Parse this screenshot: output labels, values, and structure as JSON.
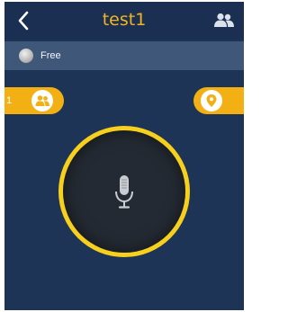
{
  "header": {
    "title": "test1",
    "back_icon": "chevron-left-icon",
    "members_icon": "group-icon"
  },
  "status": {
    "text": "Free",
    "indicator_icon": "status-dot-icon"
  },
  "left_tab": {
    "count": "1",
    "icon": "users-icon"
  },
  "right_tab": {
    "icon": "location-pin-icon"
  },
  "talk": {
    "icon": "microphone-icon"
  },
  "colors": {
    "background": "#1e3457",
    "header": "#1b2f52",
    "status_bar": "#3f5779",
    "accent": "#f3b014",
    "title": "#f2b521",
    "ring": "#f7cf1d",
    "talk_button": "#242a33"
  }
}
